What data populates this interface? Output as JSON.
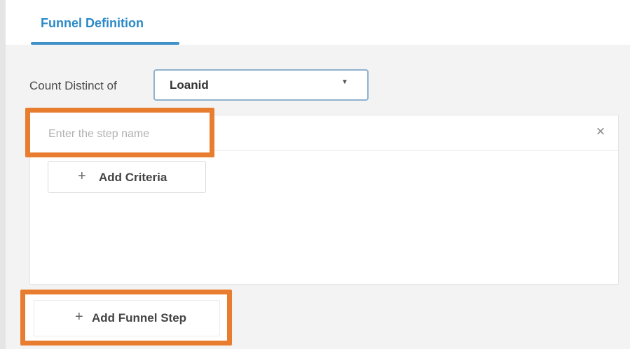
{
  "tabs": [
    {
      "label": "Funnel Definition",
      "active": true
    }
  ],
  "count_distinct": {
    "label": "Count Distinct of",
    "selected": "Loanid"
  },
  "step": {
    "name_value": "",
    "name_placeholder": "Enter the step name",
    "close_icon": "close-icon",
    "add_criteria_label": "Add Criteria"
  },
  "add_funnel_step_label": "Add Funnel Step",
  "colors": {
    "accent": "#2b89c8",
    "highlight": "#e87d2f",
    "background": "#f3f3f3"
  }
}
